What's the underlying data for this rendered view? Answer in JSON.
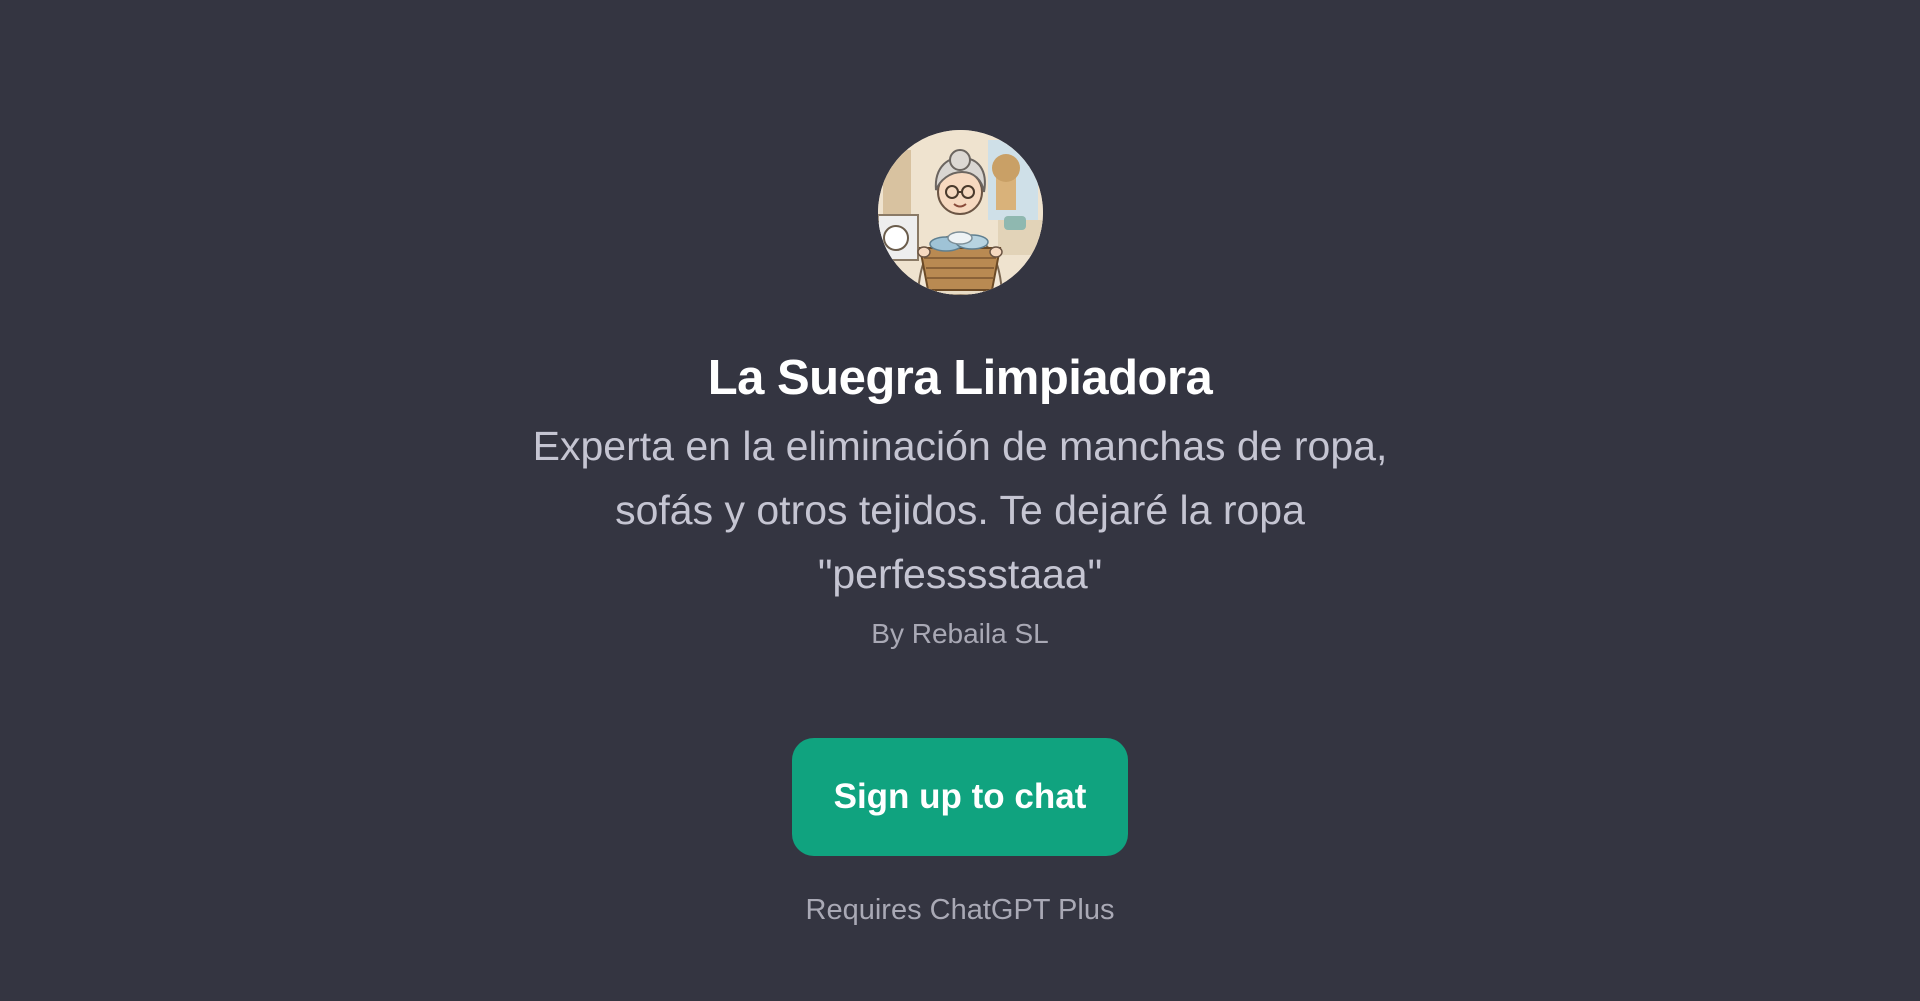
{
  "gpt": {
    "avatar_icon": "laundry-grandmother-avatar",
    "title": "La Suegra Limpiadora",
    "description": "Experta en la eliminación de manchas de ropa, sofás y otros tejidos. Te dejaré la ropa \"perfesssstaaa\"",
    "author": "By Rebaila SL"
  },
  "cta": {
    "label": "Sign up to chat"
  },
  "footer": {
    "requires": "Requires ChatGPT Plus"
  },
  "colors": {
    "background": "#343541",
    "accent": "#10a37f",
    "title": "#ffffff",
    "text_muted": "#c5c5d2"
  }
}
